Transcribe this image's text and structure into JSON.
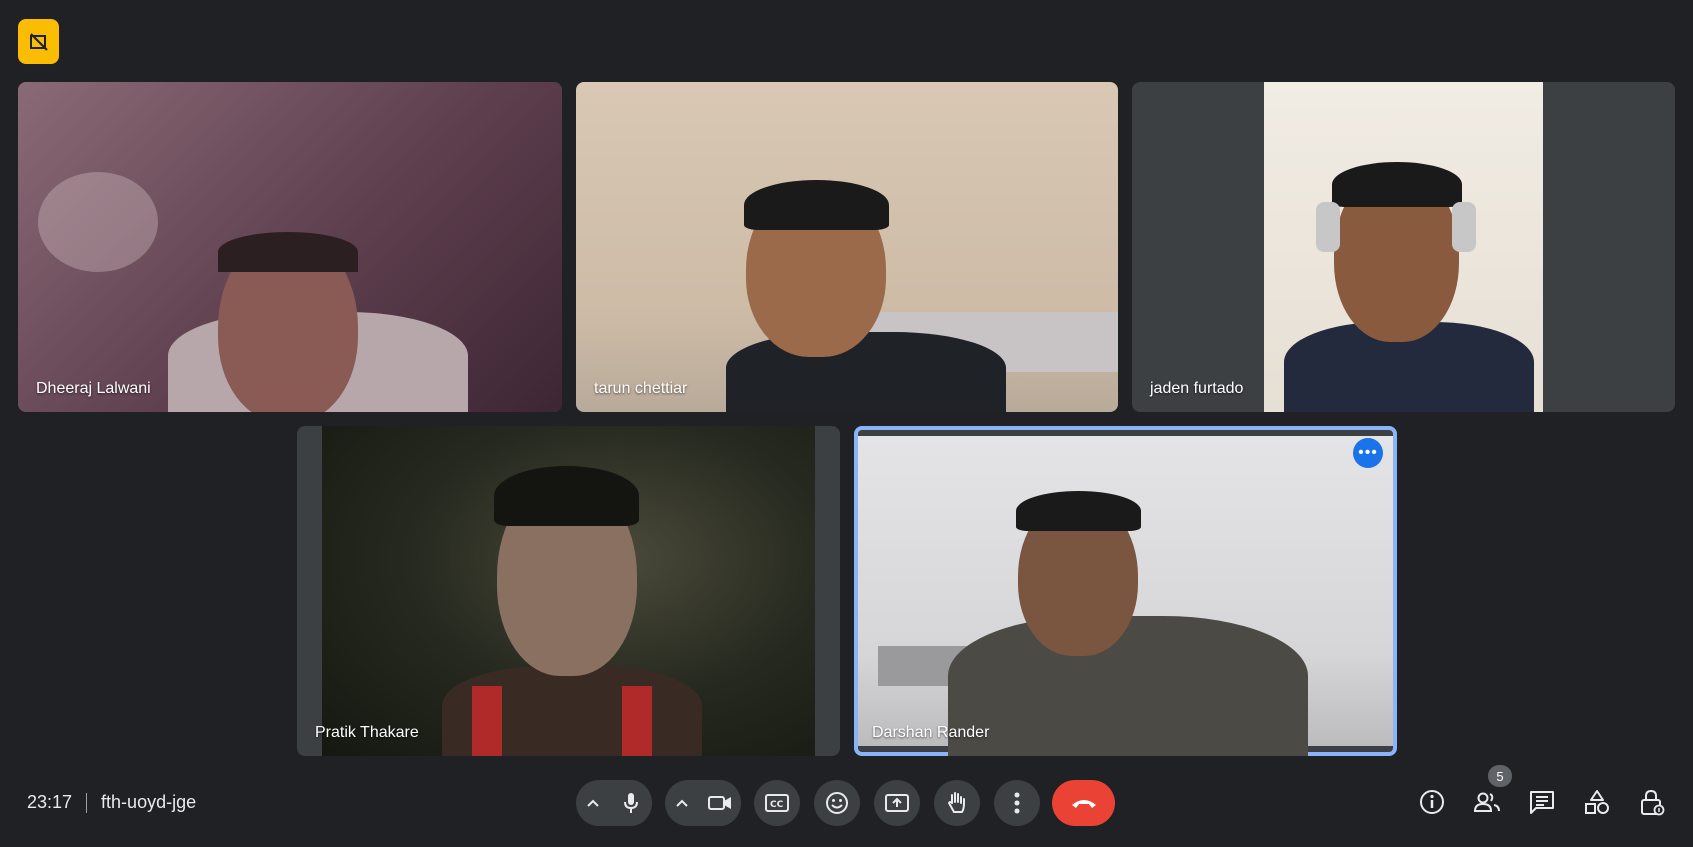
{
  "participants": [
    {
      "name": "Dheeraj Lalwani"
    },
    {
      "name": "tarun chettiar"
    },
    {
      "name": "jaden furtado"
    },
    {
      "name": "Pratik Thakare"
    },
    {
      "name": "Darshan Rander"
    }
  ],
  "meeting": {
    "time": "23:17",
    "code": "fth-uoyd-jge",
    "participant_count": "5"
  },
  "icons": {
    "top_badge": "no-recording-icon",
    "mic": "microphone-icon",
    "camera": "camera-icon",
    "captions": "closed-captions-icon",
    "emoji": "emoji-icon",
    "present": "present-screen-icon",
    "hand": "raise-hand-icon",
    "more": "more-vert-icon",
    "end": "end-call-icon",
    "info": "info-icon",
    "people": "people-icon",
    "chat": "chat-icon",
    "activities": "activities-icon",
    "host": "host-controls-icon"
  },
  "colors": {
    "background": "#202124",
    "control": "#3c4043",
    "end_call": "#ea4335",
    "highlight": "#8ab4f8",
    "badge": "#fbbc04"
  }
}
